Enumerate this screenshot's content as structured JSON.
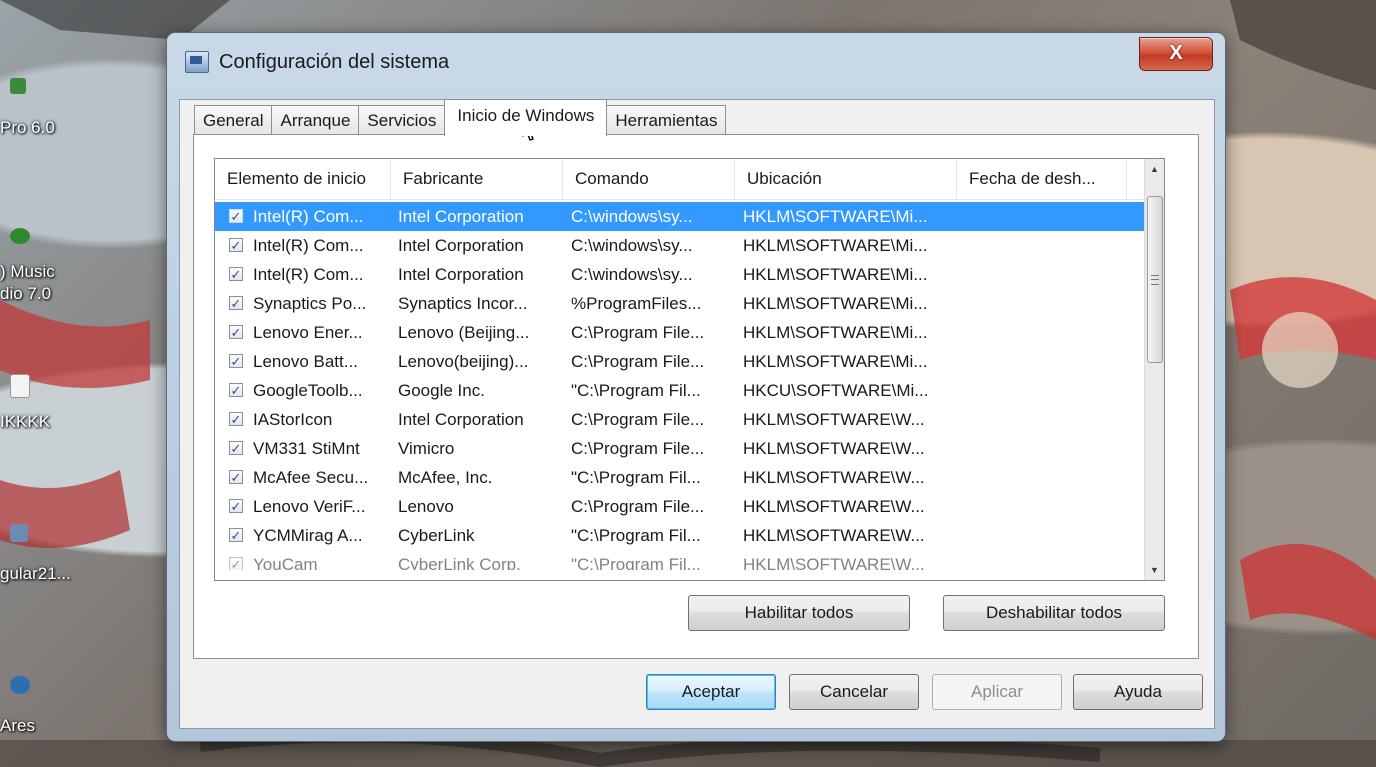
{
  "desktop": {
    "icons": [
      {
        "label": "Pro 6.0"
      },
      {
        "label": ") Music"
      },
      {
        "label": "dio 7.0"
      },
      {
        "label": "IKKKK"
      },
      {
        "label": "gular21..."
      },
      {
        "label": "Ares"
      }
    ]
  },
  "window": {
    "title": "Configuración del sistema",
    "close_label": "X",
    "icon": "system-config-icon"
  },
  "tabs": [
    {
      "label": "General",
      "active": false
    },
    {
      "label": "Arranque",
      "active": false
    },
    {
      "label": "Servicios",
      "active": false
    },
    {
      "label": "Inicio de Windows",
      "active": true
    },
    {
      "label": "Herramientas",
      "active": false
    }
  ],
  "startup_list": {
    "columns": [
      "Elemento de inicio",
      "Fabricante",
      "Comando",
      "Ubicación",
      "Fecha de desh..."
    ],
    "check_glyph": "✓",
    "rows": [
      {
        "item": "Intel(R) Com...",
        "maker": "Intel Corporation",
        "command": "C:\\windows\\sy...",
        "location": "HKLM\\SOFTWARE\\Mi...",
        "checked": true,
        "selected": true
      },
      {
        "item": "Intel(R) Com...",
        "maker": "Intel Corporation",
        "command": "C:\\windows\\sy...",
        "location": "HKLM\\SOFTWARE\\Mi...",
        "checked": true
      },
      {
        "item": "Intel(R) Com...",
        "maker": "Intel Corporation",
        "command": "C:\\windows\\sy...",
        "location": "HKLM\\SOFTWARE\\Mi...",
        "checked": true
      },
      {
        "item": "Synaptics Po...",
        "maker": "Synaptics Incor...",
        "command": "%ProgramFiles...",
        "location": "HKLM\\SOFTWARE\\Mi...",
        "checked": true
      },
      {
        "item": "Lenovo Ener...",
        "maker": "Lenovo (Beijing...",
        "command": "C:\\Program File...",
        "location": "HKLM\\SOFTWARE\\Mi...",
        "checked": true
      },
      {
        "item": "Lenovo Batt...",
        "maker": "Lenovo(beijing)...",
        "command": "C:\\Program File...",
        "location": "HKLM\\SOFTWARE\\Mi...",
        "checked": true
      },
      {
        "item": "GoogleToolb...",
        "maker": "Google Inc.",
        "command": "\"C:\\Program Fil...",
        "location": "HKCU\\SOFTWARE\\Mi...",
        "checked": true
      },
      {
        "item": "IAStorIcon",
        "maker": "Intel Corporation",
        "command": "C:\\Program File...",
        "location": "HKLM\\SOFTWARE\\W...",
        "checked": true
      },
      {
        "item": "VM331 StiMnt",
        "maker": "Vimicro",
        "command": "C:\\Program File...",
        "location": "HKLM\\SOFTWARE\\W...",
        "checked": true
      },
      {
        "item": "McAfee Secu...",
        "maker": "McAfee, Inc.",
        "command": "\"C:\\Program Fil...",
        "location": "HKLM\\SOFTWARE\\W...",
        "checked": true
      },
      {
        "item": "Lenovo VeriF...",
        "maker": "Lenovo",
        "command": "C:\\Program File...",
        "location": "HKLM\\SOFTWARE\\W...",
        "checked": true
      },
      {
        "item": "YCMMirag A...",
        "maker": "CyberLink",
        "command": "\"C:\\Program Fil...",
        "location": "HKLM\\SOFTWARE\\W...",
        "checked": true
      },
      {
        "item": "YouCam",
        "maker": "CyberLink Corp.",
        "command": "\"C:\\Program Fil...",
        "location": "HKLM\\SOFTWARE\\W...",
        "checked": true
      }
    ]
  },
  "panel_buttons": {
    "enable_all": "Habilitar todos",
    "disable_all": "Deshabilitar todos"
  },
  "footer_buttons": {
    "ok": "Aceptar",
    "cancel": "Cancelar",
    "apply": "Aplicar",
    "help": "Ayuda"
  },
  "colors": {
    "selection": "#3399ff",
    "close_button": "#c23a22"
  }
}
